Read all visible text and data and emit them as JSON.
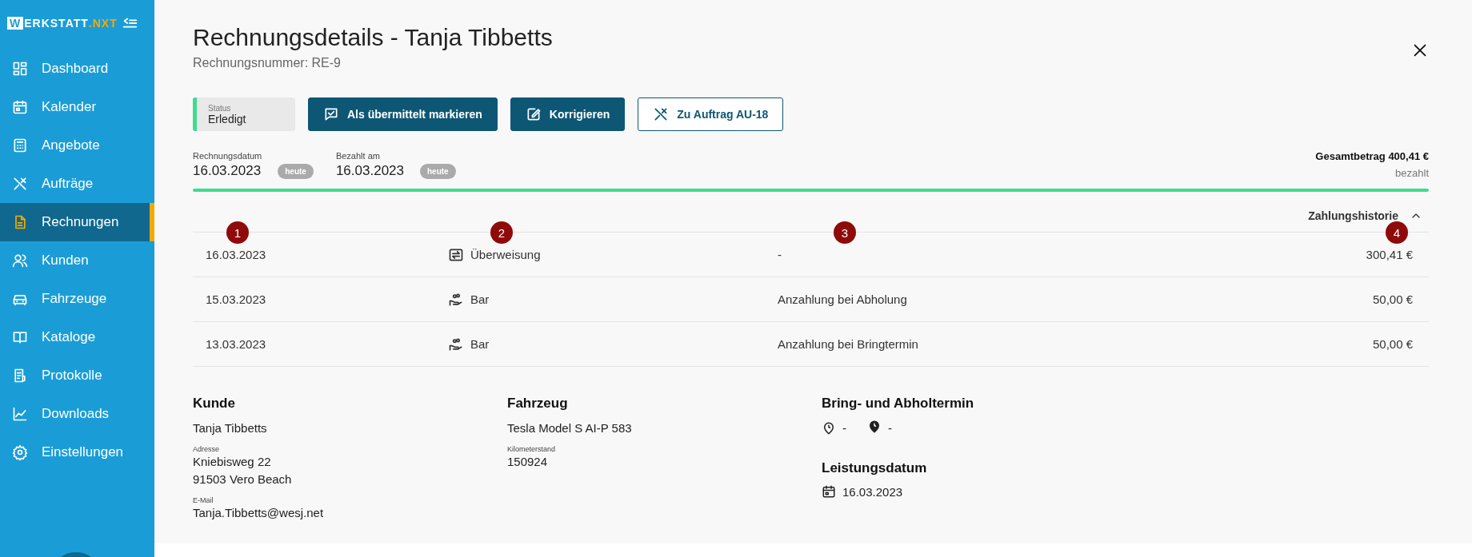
{
  "sidebar": {
    "logo": {
      "initial": "W",
      "name": "ERKSTATT",
      "suffix": ".NXT"
    },
    "items": [
      {
        "label": "Dashboard",
        "selected": false
      },
      {
        "label": "Kalender",
        "selected": false
      },
      {
        "label": "Angebote",
        "selected": false
      },
      {
        "label": "Aufträge",
        "selected": false
      },
      {
        "label": "Rechnungen",
        "selected": true
      },
      {
        "label": "Kunden",
        "selected": false
      },
      {
        "label": "Fahrzeuge",
        "selected": false
      },
      {
        "label": "Kataloge",
        "selected": false
      },
      {
        "label": "Protokolle",
        "selected": false
      },
      {
        "label": "Downloads",
        "selected": false
      },
      {
        "label": "Einstellungen",
        "selected": false
      }
    ]
  },
  "header": {
    "title": "Rechnungsdetails - Tanja Tibbetts",
    "subtitle": "Rechnungsnummer: RE-9"
  },
  "status": {
    "label": "Status",
    "value": "Erledigt",
    "color": "#3ddc8f"
  },
  "actions": [
    {
      "label": "Als übermittelt markieren",
      "kind": "primary"
    },
    {
      "label": "Korrigieren",
      "kind": "primary"
    },
    {
      "label": "Zu Auftrag AU-18",
      "kind": "outline"
    }
  ],
  "dates": [
    {
      "label": "Rechnungsdatum",
      "value": "16.03.2023",
      "badge": "heute"
    },
    {
      "label": "Bezahlt am",
      "value": "16.03.2023",
      "badge": "heute"
    }
  ],
  "total": {
    "label": "Gesamtbetrag 400,41 €",
    "status": "bezahlt"
  },
  "payment_history": {
    "title": "Zahlungshistorie",
    "expanded": true,
    "column_markers": [
      "1",
      "2",
      "3",
      "4"
    ],
    "rows": [
      {
        "date": "16.03.2023",
        "method": {
          "kind": "transfer",
          "label": "Überweisung"
        },
        "note": "-",
        "amount": "300,41 €"
      },
      {
        "date": "15.03.2023",
        "method": {
          "kind": "cash",
          "label": "Bar"
        },
        "note": "Anzahlung bei Abholung",
        "amount": "50,00 €"
      },
      {
        "date": "13.03.2023",
        "method": {
          "kind": "cash",
          "label": "Bar"
        },
        "note": "Anzahlung bei Bringtermin",
        "amount": "50,00 €"
      }
    ]
  },
  "customer": {
    "title": "Kunde",
    "name": "Tanja Tibbetts",
    "address_label": "Adresse",
    "address_lines": [
      "Kniebisweg 22",
      "91503 Vero Beach"
    ],
    "email_label": "E-Mail",
    "email": "Tanja.Tibbetts@wesj.net"
  },
  "vehicle": {
    "title": "Fahrzeug",
    "name": "Tesla Model S AI-P 583",
    "mileage_label": "Kilometerstand",
    "mileage": "150924"
  },
  "appointment": {
    "title": "Bring- und Abholtermin",
    "drop_off": "-",
    "pick_up": "-"
  },
  "service_date": {
    "title": "Leistungsdatum",
    "value": "16.03.2023"
  }
}
